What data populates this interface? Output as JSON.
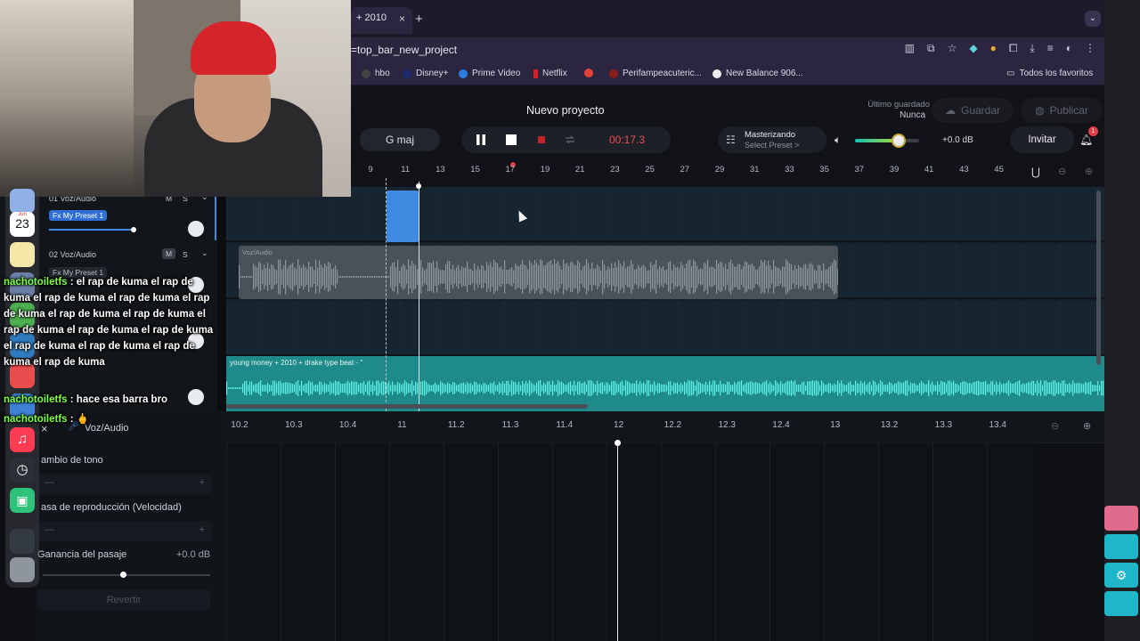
{
  "browser": {
    "tab_title": "+ 2010",
    "tab_close": "×",
    "new_tab": "+",
    "url": "=top_bar_new_project",
    "bookmarks": [
      "hbo",
      "Disney+",
      "Prime Video",
      "Netflix",
      "Perifampeacuteric...",
      "New Balance 906..."
    ],
    "all_bookmarks": "Todos los favoritos"
  },
  "header": {
    "project_title": "Nuevo proyecto",
    "last_saved_label": "Último guardado",
    "last_saved_value": "Nunca",
    "save_label": "Guardar",
    "publish_label": "Publicar",
    "key": "G maj",
    "time": "00:17.3",
    "mastering_title": "Masterizando",
    "mastering_preset": "Select Preset >",
    "volume_db": "+0.0 dB",
    "volume_level": 0.68,
    "invite_label": "Invitar",
    "notif_count": "1"
  },
  "ruler_labels": [
    "9",
    "11",
    "13",
    "15",
    "17",
    "19",
    "21",
    "23",
    "25",
    "27",
    "29",
    "31",
    "33",
    "35",
    "37",
    "39",
    "41",
    "43",
    "45"
  ],
  "tracks": [
    {
      "name": "01  Voz/Audio",
      "fx": "Fx My Preset 1",
      "m": "M",
      "s": "S"
    },
    {
      "name": "02  Voz/Audio",
      "fx": "Fx My Preset 1",
      "m": "M",
      "s": "S"
    }
  ],
  "clips": {
    "voice_label": "Voz/Audio",
    "beat_label": "young money + 2010 + drake type beat -  ''"
  },
  "editor": {
    "track_label": "Voz/Audio",
    "close": "×",
    "ruler_labels": [
      "10.2",
      "10.3",
      "10.4",
      "11",
      "11.2",
      "11.3",
      "11.4",
      "12",
      "12.2",
      "12.3",
      "12.4",
      "13",
      "13.2",
      "13.3",
      "13.4"
    ],
    "pitch_label": "ambio de tono",
    "rate_label": "asa de reproducción (Velocidad)",
    "gain_label": "Ganancia del pasaje",
    "gain_value": "+0.0 dB",
    "minus": "—",
    "plus": "+",
    "revert_label": "Revertir"
  },
  "dock": {
    "calendar_month": "Jun",
    "calendar_day": "23"
  },
  "chat": [
    {
      "user": "nachotoiletfs",
      "text": ": el rap de kuma el rap de kuma el rap de kuma el rap de kuma el rap de kuma el rap de kuma el rap de kuma el rap de kuma el rap de kuma el rap de kuma el rap de kuma el rap de kuma el rap de kuma el rap de kuma"
    },
    {
      "user": "nachotoiletfs",
      "text": ": hace esa barra bro"
    },
    {
      "user": "nachotoiletfs",
      "text": ": 🖕"
    }
  ],
  "colors": {
    "accent_blue": "#3f8ae0",
    "accent_teal": "#1e8a8a",
    "record_red": "#ef4b55",
    "chat_user": "#7dff3c"
  }
}
